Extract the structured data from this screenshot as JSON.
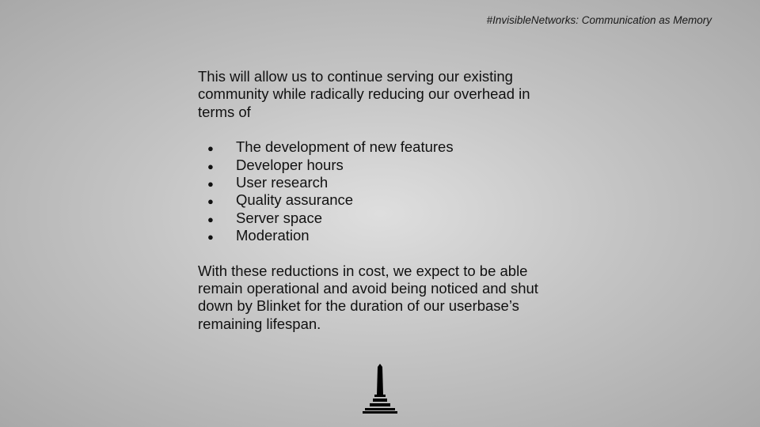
{
  "header": {
    "tag": "#InvisibleNetworks: Communication as Memory"
  },
  "content": {
    "intro": "This will allow us to continue serving our existing community while radically reducing our overhead in terms of",
    "bullet_glyph": "●",
    "bullets": [
      "The development of new features",
      "Developer hours",
      "User research",
      "Quality assurance",
      "Server space",
      "Moderation"
    ],
    "conclusion": "With these reductions in cost, we expect to be able remain operational and avoid being noticed and shut down by Blinket for the duration of our userbase’s remaining lifespan."
  },
  "footer": {
    "icon": "monument-icon"
  },
  "colors": {
    "background_center": "#dedede",
    "background_edge": "#a8a8a8",
    "text": "#111111"
  }
}
